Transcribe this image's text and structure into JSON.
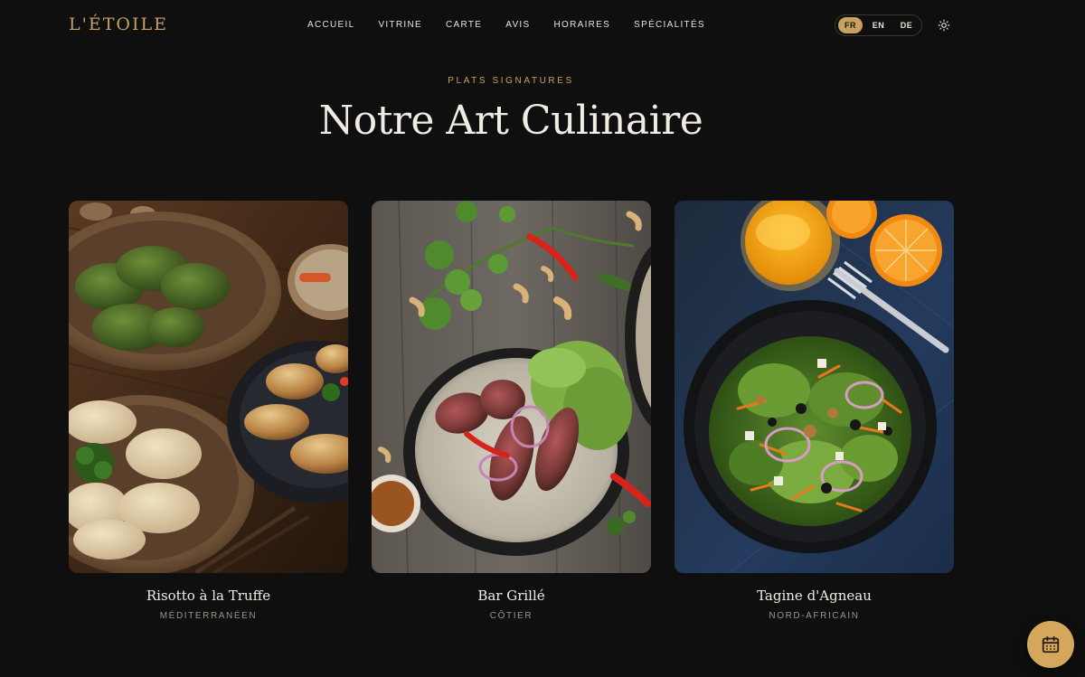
{
  "brand": {
    "logo": "L'ÉTOILE",
    "accent": "#c9a15e"
  },
  "nav": {
    "items": [
      "ACCUEIL",
      "VITRINE",
      "CARTE",
      "AVIS",
      "HORAIRES",
      "SPÉCIALITÉS"
    ]
  },
  "languages": {
    "options": [
      "FR",
      "EN",
      "DE"
    ],
    "selected": "FR"
  },
  "theme_toggle": {
    "icon": "sun-icon"
  },
  "section": {
    "eyebrow": "PLATS SIGNATURES",
    "title": "Notre Art Culinaire"
  },
  "dishes": [
    {
      "name": "Risotto à la Truffe",
      "region": "MÉDITERRANÉEN",
      "image": "dumplings-photo"
    },
    {
      "name": "Bar Grillé",
      "region": "CÔTIER",
      "image": "grilled-steak-photo"
    },
    {
      "name": "Tagine d'Agneau",
      "region": "NORD-AFRICAIN",
      "image": "salad-photo"
    }
  ],
  "reservation_fab": {
    "icon": "calendar-icon",
    "color": "#d4a75c"
  }
}
